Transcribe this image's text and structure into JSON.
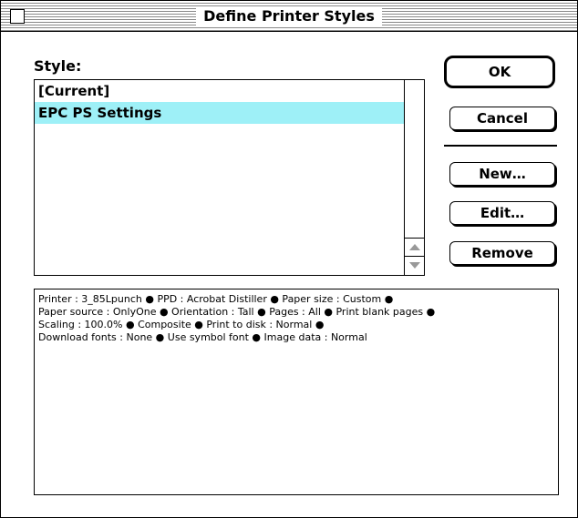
{
  "window": {
    "title": "Define Printer Styles"
  },
  "style_list": {
    "label": "Style:",
    "items": [
      {
        "label": "[Current]",
        "selected": false
      },
      {
        "label": "EPC PS Settings",
        "selected": true
      }
    ]
  },
  "buttons": {
    "ok": "OK",
    "cancel": "Cancel",
    "new": "New…",
    "edit": "Edit…",
    "remove": "Remove"
  },
  "info": {
    "lines": [
      "Printer : 3_85Lpunch ● PPD : Acrobat Distiller ● Paper size : Custom ●",
      "Paper source : OnlyOne ● Orientation : Tall ● Pages : All ● Print blank pages ●",
      "Scaling : 100.0% ● Composite ● Print to disk : Normal ●",
      "Download fonts : None ● Use symbol font ● Image data : Normal"
    ]
  },
  "colors": {
    "selection": "#9ef0f7",
    "border": "#000000"
  }
}
